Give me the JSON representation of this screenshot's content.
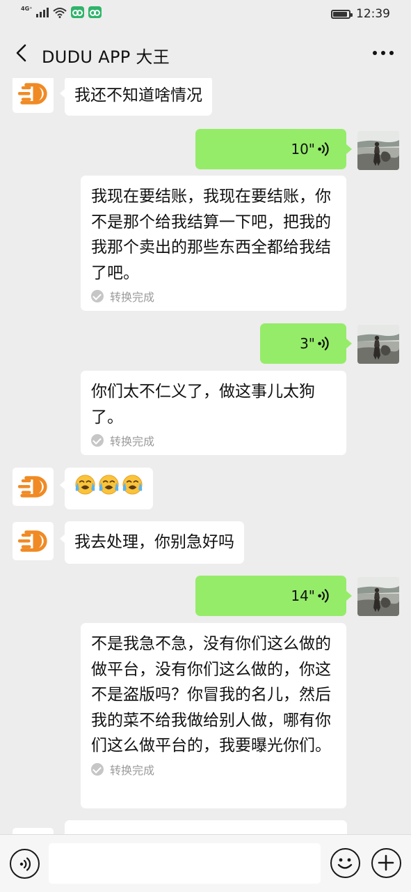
{
  "status_bar": {
    "network": "4G⁺",
    "time": "12:39",
    "battery_percent": 90
  },
  "header": {
    "title": "DUDU APP 大王"
  },
  "messages": [
    {
      "type": "incoming_text",
      "text": "我还不知道啥情况"
    },
    {
      "type": "outgoing_voice",
      "duration": "10\"",
      "transcript": "我现在要结账，我现在要结账，你不是那个给我结算一下吧，把我的我那个卖出的那些东西全都给我结了吧。",
      "transcript_status": "转换完成"
    },
    {
      "type": "outgoing_voice",
      "duration": "3\"",
      "transcript": "你们太不仁义了，做这事儿太狗了。",
      "transcript_status": "转换完成"
    },
    {
      "type": "incoming_emoji",
      "emojis": [
        "😭",
        "😭",
        "😭"
      ]
    },
    {
      "type": "incoming_text",
      "text": "我去处理，你别急好吗"
    },
    {
      "type": "outgoing_voice",
      "duration": "14\"",
      "transcript": "不是我急不急，没有你们这么做的做平台，没有你们这么做的，你这不是盗版吗？你冒我的名儿，然后我的菜不给我做给别人做，哪有你们这么做平台的，我要曝光你们。",
      "transcript_status": "转换完成"
    }
  ],
  "colors": {
    "background": "#ededed",
    "outgoing_bubble": "#95ec69",
    "incoming_bubble": "#ffffff",
    "brand_orange": "#f08a24"
  },
  "icons": {
    "back": "chevron-left-icon",
    "more": "more-dots-icon",
    "voice_toggle": "voice-icon",
    "emoji": "emoji-icon",
    "plus": "plus-icon",
    "voice_wave": "voice-wave-icon",
    "check": "check-circle-icon"
  }
}
